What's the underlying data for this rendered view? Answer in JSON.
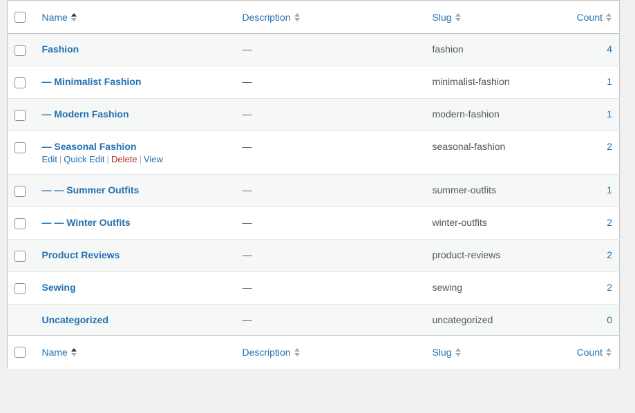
{
  "table": {
    "columns": [
      {
        "key": "cb",
        "label": "",
        "sortable": false,
        "sort": "none"
      },
      {
        "key": "name",
        "label": "Name",
        "sortable": true,
        "sort": "asc"
      },
      {
        "key": "desc",
        "label": "Description",
        "sortable": true,
        "sort": "none"
      },
      {
        "key": "slug",
        "label": "Slug",
        "sortable": true,
        "sort": "none"
      },
      {
        "key": "count",
        "label": "Count",
        "sortable": true,
        "sort": "none"
      }
    ],
    "description_placeholder": "—",
    "level_prefix_1": "—",
    "level_prefix_2": "— —",
    "row_actions": {
      "edit": "Edit",
      "quick_edit": "Quick Edit",
      "delete": "Delete",
      "view": "View",
      "separator": "|"
    },
    "rows": [
      {
        "name": "Fashion",
        "level": 0,
        "description": "—",
        "slug": "fashion",
        "count": "4",
        "checkbox": true,
        "actions": false
      },
      {
        "name": "Minimalist Fashion",
        "level": 1,
        "description": "—",
        "slug": "minimalist-fashion",
        "count": "1",
        "checkbox": true,
        "actions": false
      },
      {
        "name": "Modern Fashion",
        "level": 1,
        "description": "—",
        "slug": "modern-fashion",
        "count": "1",
        "checkbox": true,
        "actions": false
      },
      {
        "name": "Seasonal Fashion",
        "level": 1,
        "description": "—",
        "slug": "seasonal-fashion",
        "count": "2",
        "checkbox": true,
        "actions": true
      },
      {
        "name": "Summer Outfits",
        "level": 2,
        "description": "—",
        "slug": "summer-outfits",
        "count": "1",
        "checkbox": true,
        "actions": false
      },
      {
        "name": "Winter Outfits",
        "level": 2,
        "description": "—",
        "slug": "winter-outfits",
        "count": "2",
        "checkbox": true,
        "actions": false
      },
      {
        "name": "Product Reviews",
        "level": 0,
        "description": "—",
        "slug": "product-reviews",
        "count": "2",
        "checkbox": true,
        "actions": false
      },
      {
        "name": "Sewing",
        "level": 0,
        "description": "—",
        "slug": "sewing",
        "count": "2",
        "checkbox": true,
        "actions": false
      },
      {
        "name": "Uncategorized",
        "level": 0,
        "description": "—",
        "slug": "uncategorized",
        "count": "0",
        "checkbox": false,
        "actions": false
      }
    ]
  },
  "colors": {
    "link": "#2271b1",
    "delete": "#b32d2e",
    "text": "#50575e",
    "stripe": "#f6f7f7",
    "border": "#c3c4c7",
    "page_bg": "#f0f0f1"
  }
}
